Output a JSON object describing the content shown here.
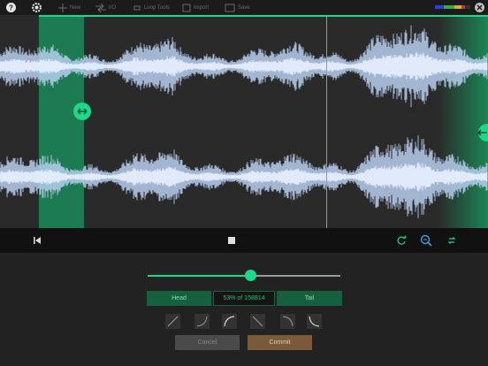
{
  "toolbar": {
    "items": [
      {
        "name": "help-icon"
      },
      {
        "name": "gear-icon"
      },
      {
        "label": "New",
        "icon": "plus-icon"
      },
      {
        "label": "I/O",
        "icon": "io-icon"
      },
      {
        "label": "Loop Tools",
        "icon": "loop-icon"
      },
      {
        "label": "Import",
        "icon": "import-icon"
      },
      {
        "label": "Save",
        "icon": "save-icon"
      }
    ],
    "close_icon": "close-icon",
    "meter_colors": [
      "#2f3fd6",
      "#3aa84a",
      "#d6b02a",
      "#c0392b"
    ]
  },
  "colors": {
    "accent": "#19d98a",
    "region": "#1a8a58",
    "wave": "#b7cff0",
    "background": "#2a2a2a"
  },
  "transport": {
    "rewind_icon": "skip-to-start-icon",
    "stop_icon": "stop-icon",
    "loop_icon": "loop-refresh-icon",
    "zoom_icon": "zoom-icon",
    "repeat_icon": "repeat-icon"
  },
  "panel": {
    "slider_fraction": 0.53,
    "segment": {
      "head_label": "Head",
      "middle_label": "53% of 158814",
      "tail_label": "Tail"
    },
    "curves": [
      "linear-up",
      "convex",
      "concave-up",
      "linear-down",
      "convex-down",
      "concave-down"
    ],
    "cancel_label": "Cancel",
    "commit_label": "Commit"
  }
}
